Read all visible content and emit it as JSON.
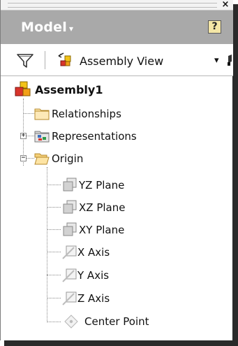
{
  "panel": {
    "close_glyph": "×",
    "title": "Model",
    "title_caret": "▾",
    "help_glyph": "?"
  },
  "toolbar": {
    "filter_icon": "filter-icon",
    "view_label": "Assembly View",
    "view_dropdown_glyph": "▾"
  },
  "tree": {
    "root": {
      "label": "Assembly1",
      "icon": "assembly-icon"
    },
    "items": [
      {
        "label": "Relationships",
        "icon": "folder-closed-icon"
      },
      {
        "label": "Representations",
        "icon": "representations-icon",
        "expander": "+"
      },
      {
        "label": "Origin",
        "icon": "folder-open-icon",
        "expander": "−"
      }
    ],
    "origin_children": [
      {
        "label": "YZ Plane",
        "icon": "work-plane-icon"
      },
      {
        "label": "XZ Plane",
        "icon": "work-plane-icon"
      },
      {
        "label": "XY Plane",
        "icon": "work-plane-icon"
      },
      {
        "label": "X Axis",
        "icon": "work-axis-icon"
      },
      {
        "label": "Y Axis",
        "icon": "work-axis-icon"
      },
      {
        "label": "Z Axis",
        "icon": "work-axis-icon"
      },
      {
        "label": "Center Point",
        "icon": "work-point-icon"
      }
    ]
  }
}
